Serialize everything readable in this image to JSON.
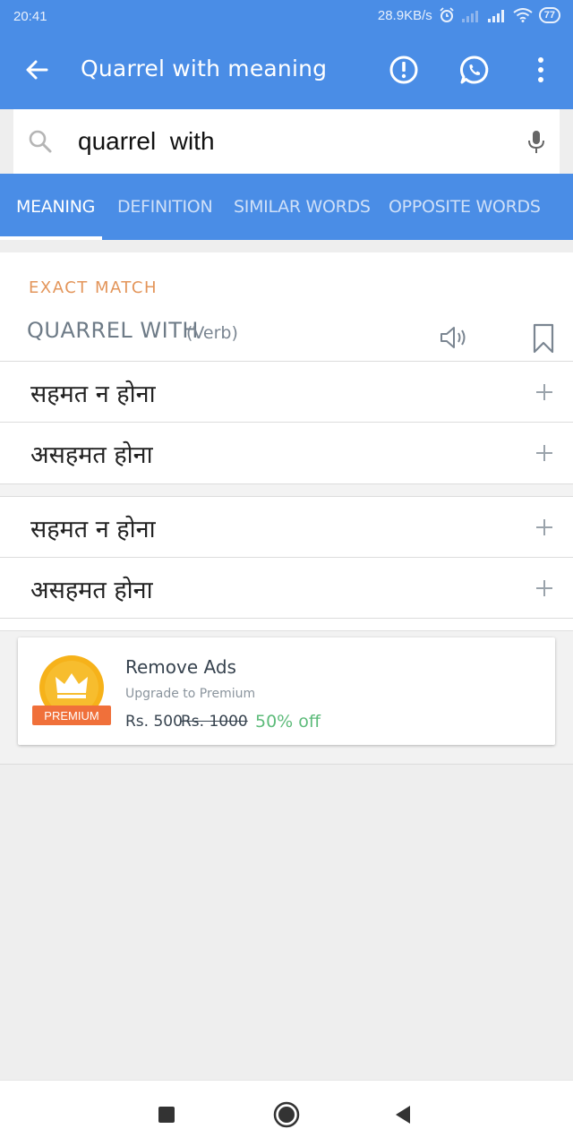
{
  "status": {
    "time": "20:41",
    "speed": "28.9KB/s",
    "battery": "77"
  },
  "appbar": {
    "title": "Quarrel with  meaning"
  },
  "search": {
    "value": "quarrel  with"
  },
  "tabs": [
    {
      "label": "MEANING",
      "active": true
    },
    {
      "label": "DEFINITION",
      "active": false
    },
    {
      "label": "SIMILAR WORDS",
      "active": false
    },
    {
      "label": "OPPOSITE WORDS",
      "active": false
    }
  ],
  "result": {
    "section_label": "EXACT MATCH",
    "word": "QUARREL WITH",
    "part_of_speech": "(Verb)",
    "meanings": [
      "सहमत न होना",
      "असहमत होना",
      "सहमत न होना",
      "असहमत होना"
    ]
  },
  "ad": {
    "badge": "PREMIUM",
    "title": "Remove Ads",
    "subtitle": "Upgrade to Premium",
    "price": "Rs. 500",
    "old_price": "Rs. 1000",
    "discount": "50% off"
  },
  "colors": {
    "primary": "#4a8de6",
    "accent_orange": "#e3955a",
    "discount_green": "#5dbb7a"
  }
}
